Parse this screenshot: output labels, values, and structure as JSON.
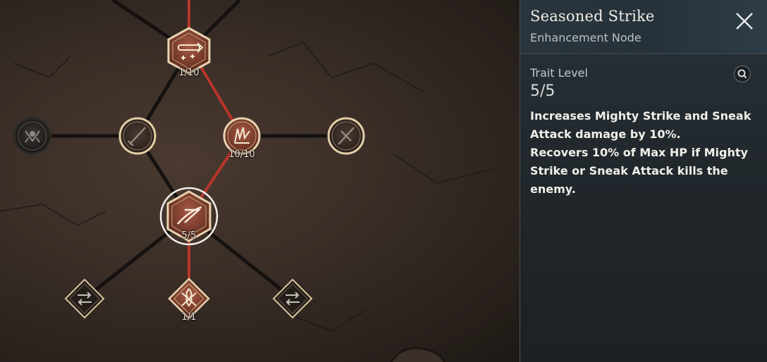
{
  "tree": {
    "nodes": [
      {
        "id": "top-enhance",
        "level": "1/10"
      },
      {
        "id": "mid-claw",
        "level": "10/10"
      },
      {
        "id": "seasoned-strike",
        "level": "5/5"
      },
      {
        "id": "bottom-flame",
        "level": "1/1"
      }
    ]
  },
  "panel": {
    "title": "Seasoned Strike",
    "subtitle": "Enhancement Node",
    "trait_label": "Trait Level",
    "trait_value": "5/5",
    "description": "Increases Mighty Strike and Sneak Attack damage by 10%.\nRecovers 10% of Max HP if Mighty Strike or Sneak Attack kills the enemy."
  },
  "colors": {
    "active_link": "#b8352a",
    "inactive_link": "#141110",
    "node_gold": "#c9a77a",
    "node_fill_active": "#7a3a2c"
  },
  "icons": {
    "close": "close-icon",
    "zoom": "magnifier-icon"
  }
}
